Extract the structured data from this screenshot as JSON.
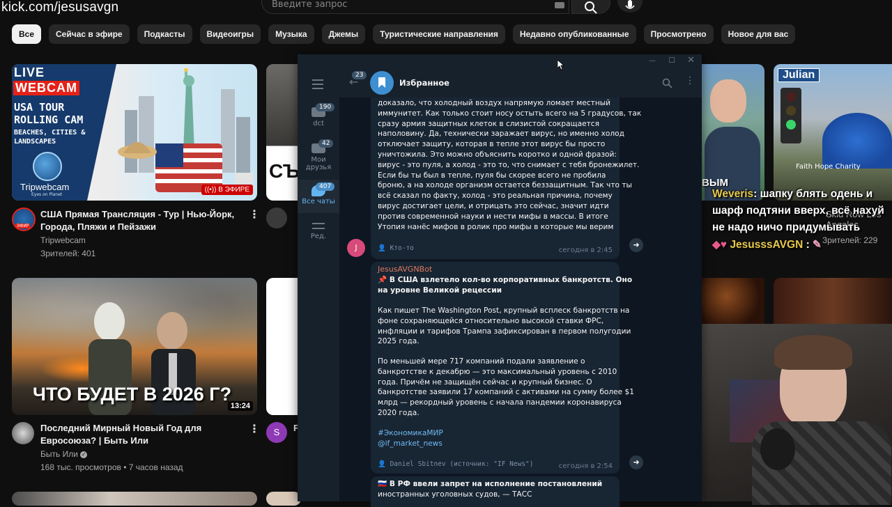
{
  "overlay": {
    "url": "kick.com/jesusavgn"
  },
  "search": {
    "placeholder": "Введите запрос"
  },
  "chips": [
    "Все",
    "Сейчас в эфире",
    "Подкасты",
    "Видеоигры",
    "Музыка",
    "Джемы",
    "Туристические направления",
    "Недавно опубликованные",
    "Просмотрено",
    "Новое для вас"
  ],
  "videos": [
    {
      "title_line1": "США Прямая Трансляция - Тур | Нью-Йорк,",
      "title_line2": "Города, Пляжи и Пейзажи",
      "channel": "Tripwebcam",
      "meta": "Зрителей: 401",
      "avatar_label": "ЭФИР",
      "thumb": {
        "live": "LIVE",
        "webcam": "WEBCAM",
        "line1": "USA TOUR",
        "line2": "ROLLING CAM",
        "line3": "BEACHES, CITIES &",
        "line4": "LANDSCAPES",
        "brand": "Tripwebcam",
        "brand_sub": "Eyes on Planet",
        "badge": "В ЭФИРЕ"
      }
    },
    {
      "title_line1": "Последний Мирный Новый Год для",
      "title_line2": "Евросоюза? | Быть Или",
      "channel": "Быть Или",
      "meta": "168 тыс. просмотров • 7 часов назад",
      "thumb": {
        "text": "ЧТО БУДЕТ В 2026 Г?",
        "duration": "13:24"
      }
    }
  ],
  "partial": {
    "thumb_text": "СЪ",
    "card2_avatar": "S",
    "card2_letter": "F"
  },
  "telegram": {
    "back_badge": "23",
    "chat_title": "Избранное",
    "folders": [
      {
        "label": "dct",
        "badge": "190"
      },
      {
        "label_line1": "Мои",
        "label_line2": "друзья",
        "badge": "42"
      },
      {
        "label": "Все чаты",
        "badge": "407"
      },
      {
        "label": "Ред."
      }
    ],
    "msg1": {
      "lines": [
        "доказало, что холодный воздух напрямую ломает местный",
        "иммунитет. Как только стоит носу остыть всего на 5 градусов, так",
        "сразу армия защитных клеток в слизистой сокращается",
        "наполовину. Да, технически заражает вирус, но именно холод",
        "отключает защиту, которая в тепле этот вирус бы просто",
        "уничтожила. Это можно объяснить коротко и одной фразой:",
        "вирус - это пуля, а холод - это то, что снимает с тебя бронежилет.",
        "Если бы ты был в тепле, пуля бы скорее всего не пробила",
        "броню, а на холоде организм остается беззащитным. Так что ты",
        "всё сказал по факту, холод - это реальная причина, почему",
        "вирус достигает цели, и отрицать это сейчас, значит идти",
        "против современной науки и нести мифы в массы. В итоге",
        "Утопия нанёс мифов в ролик про мифы в которые мы верим"
      ],
      "author": "Кто-то",
      "time": "сегодня в 2:45",
      "avatar": "J"
    },
    "msg2": {
      "sender": "JesusAVGNBot",
      "headline_line1": "📌 В США взлетело кол-во корпоративных банкротств. Оно",
      "headline_line2": "на уровне Великой рецессии",
      "p1": [
        "Как пишет The Washington Post, крупный всплеск банкротств на",
        "фоне сохраняющейся относительно высокой ставки ФРС,",
        "инфляции и тарифов Трампа зафиксирован в первом полугодии",
        "2025 года."
      ],
      "p2": [
        "По меньшей мере 717 компаний подали заявление о",
        "банкротстве к декабрю — это максимальный уровень с 2010",
        "года. Причём не защищён сейчас и крупный бизнес. О",
        "банкротстве заявили 17 компаний с активами на сумму более $1",
        "млрд — рекордный уровень с начала пандемии коронавируса",
        "2020 года."
      ],
      "tag": "#ЭкономикаМИР",
      "handle": "@if_market_news",
      "author": "Daniel Sbitnev (источник: \"IF News\")",
      "time": "сегодня в 2:54"
    },
    "msg3": {
      "line1": "🇷🇺 В РФ ввели запрет на исполнение постановлений",
      "line2": "иностранных уголовных судов, — ТАСС"
    }
  },
  "stream_chat": {
    "partial_top": "ВЫМ",
    "msg1_user": "Weveris",
    "msg1_line1": "шапку блять одень и",
    "msg1_line2": "шарф подтяни вверх, всё нахуй",
    "msg1_line3": "не надо ничо придумывать",
    "msg2_user": "JesusssAVGN",
    "viewers": "Зрителей: 229",
    "bg_text": "Faith Hope Charity",
    "skid_text": "Skid Row Los Angeles",
    "julian": "Julian"
  },
  "colors": {
    "accent_live": "#e62117",
    "tg_bg": "#0e1621",
    "tg_panel": "#17212b",
    "msg_bg": "#182533",
    "link": "#71baf2",
    "weveris": "#e8c94b",
    "jesus": "#e8c94b"
  }
}
